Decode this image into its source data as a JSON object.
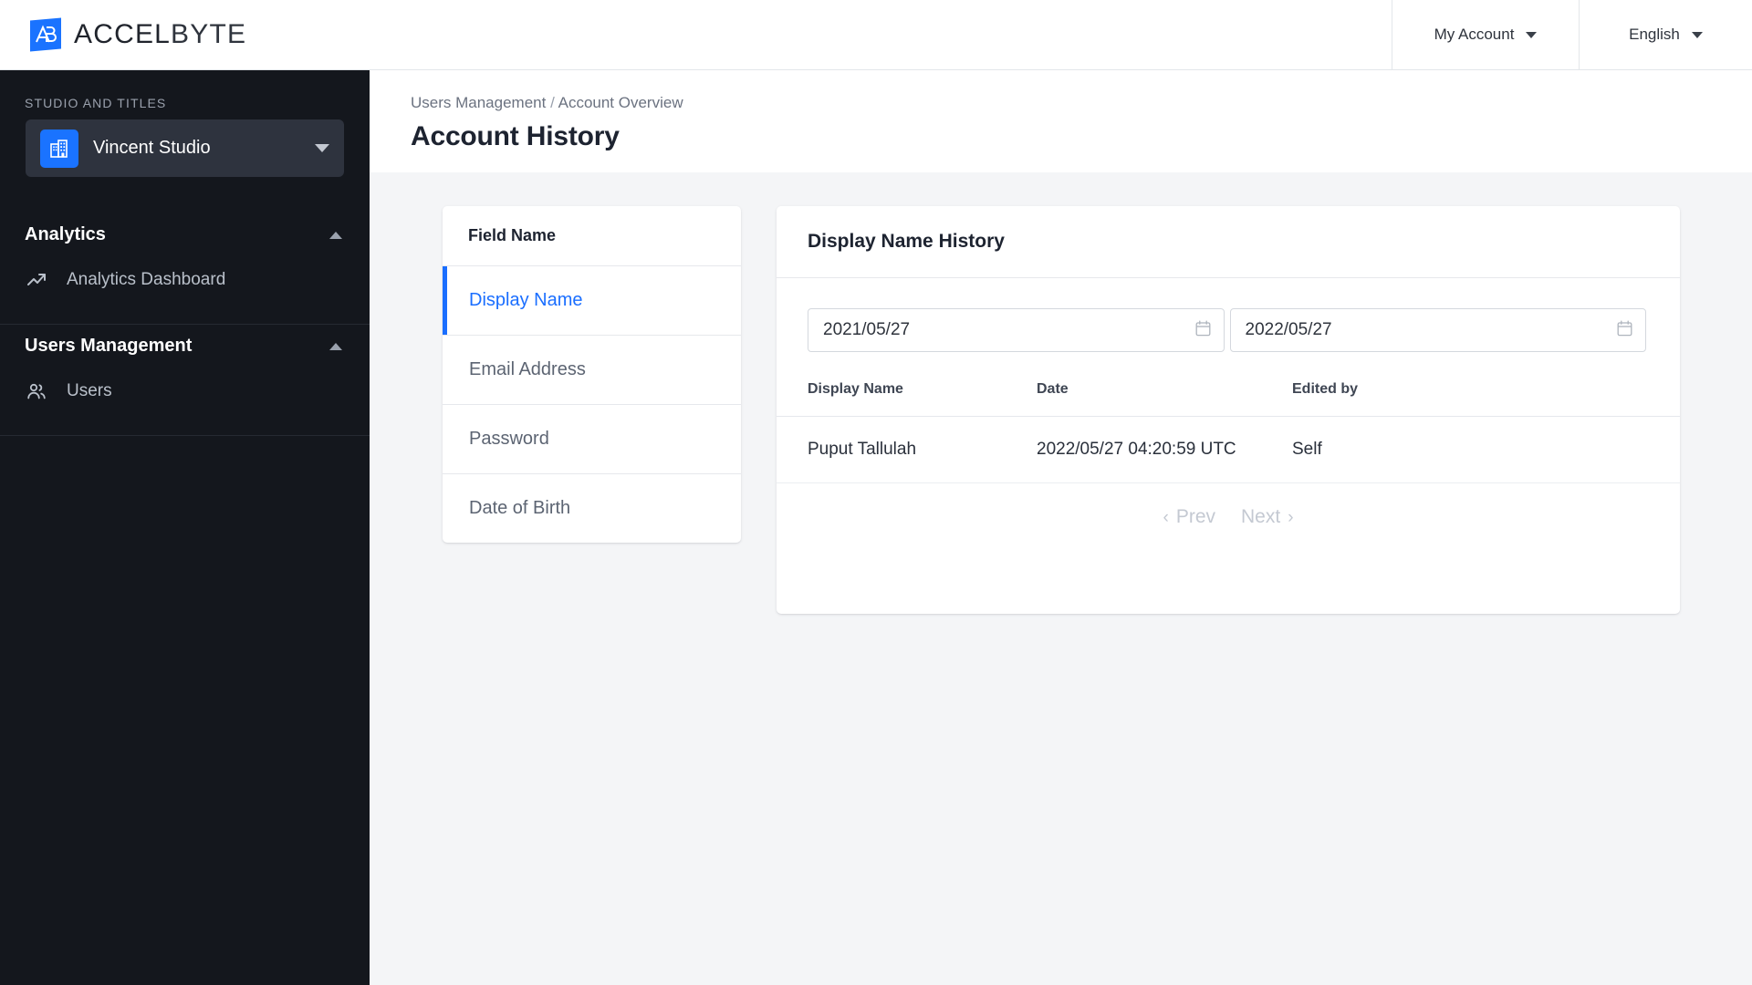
{
  "topbar": {
    "brand_primary": "ACCEL",
    "brand_secondary": "BYTE",
    "account_label": "My Account",
    "language_label": "English"
  },
  "sidebar": {
    "section_label": "STUDIO AND TITLES",
    "studio": {
      "name": "Vincent Studio",
      "icon": "building-icon"
    },
    "sections": [
      {
        "title": "Analytics",
        "items": [
          {
            "label": "Analytics Dashboard",
            "icon": "trending-up-icon"
          }
        ]
      },
      {
        "title": "Users Management",
        "items": [
          {
            "label": "Users",
            "icon": "users-icon"
          }
        ]
      }
    ]
  },
  "page": {
    "breadcrumb": {
      "parent": "Users Management",
      "separator": "/",
      "current": "Account Overview"
    },
    "title": "Account History"
  },
  "fields_panel": {
    "header": "Field Name",
    "items": [
      {
        "label": "Display Name",
        "active": true
      },
      {
        "label": "Email Address",
        "active": false
      },
      {
        "label": "Password",
        "active": false
      },
      {
        "label": "Date of Birth",
        "active": false
      }
    ]
  },
  "history_panel": {
    "title": "Display Name History",
    "date_from": {
      "value": "2021/05/27",
      "placeholder": "YYYY/MM/DD"
    },
    "date_to": {
      "value": "2022/05/27",
      "placeholder": "YYYY/MM/DD"
    },
    "table": {
      "columns": [
        "Display Name",
        "Date",
        "Edited by"
      ],
      "rows": [
        [
          "Puput Tallulah",
          "2022/05/27 04:20:59 UTC",
          "Self"
        ]
      ]
    },
    "pagination": {
      "prev_label": "Prev",
      "next_label": "Next",
      "prev_arrow": "‹",
      "next_arrow": "›"
    }
  },
  "colors": {
    "accent_blue": "#1a6eff",
    "brand_blue": "#1a73ff",
    "sidebar_bg": "#14171d",
    "content_bg": "#f4f5f7"
  }
}
